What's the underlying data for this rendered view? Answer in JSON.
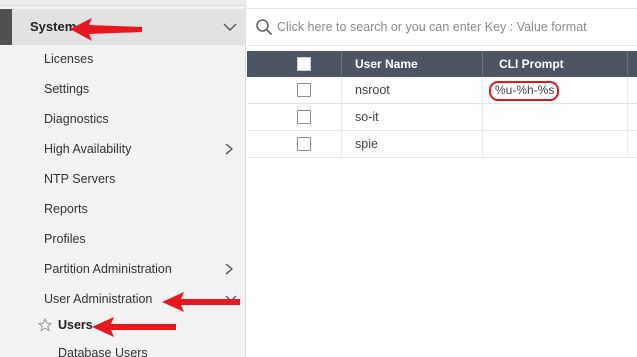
{
  "sidebar": {
    "section": {
      "label": "System"
    },
    "items": [
      {
        "label": "Licenses",
        "has_submenu": false
      },
      {
        "label": "Settings",
        "has_submenu": false
      },
      {
        "label": "Diagnostics",
        "has_submenu": false
      },
      {
        "label": "High Availability",
        "has_submenu": true
      },
      {
        "label": "NTP Servers",
        "has_submenu": false
      },
      {
        "label": "Reports",
        "has_submenu": false
      },
      {
        "label": "Profiles",
        "has_submenu": false
      },
      {
        "label": "Partition Administration",
        "has_submenu": true
      },
      {
        "label": "User Administration",
        "has_submenu": true,
        "expanded": true
      }
    ],
    "subitems": [
      {
        "label": "Users",
        "selected": true,
        "icon": "star-icon"
      },
      {
        "label": "Database Users"
      }
    ]
  },
  "search": {
    "placeholder": "Click here to search or you can enter Key : Value format",
    "icon": "search-icon"
  },
  "table": {
    "columns": [
      "User Name",
      "CLI Prompt"
    ],
    "rows": [
      {
        "user_name": "nsroot",
        "cli_prompt": "%u-%h-%s",
        "highlighted": true
      },
      {
        "user_name": "so-it",
        "cli_prompt": ""
      },
      {
        "user_name": "spie",
        "cli_prompt": ""
      }
    ]
  },
  "colors": {
    "header_bg": "#4d5463",
    "annotation_red": "#e8171d",
    "sidebar_bg": "#f2f2f2",
    "selected_bar": "#505050"
  }
}
